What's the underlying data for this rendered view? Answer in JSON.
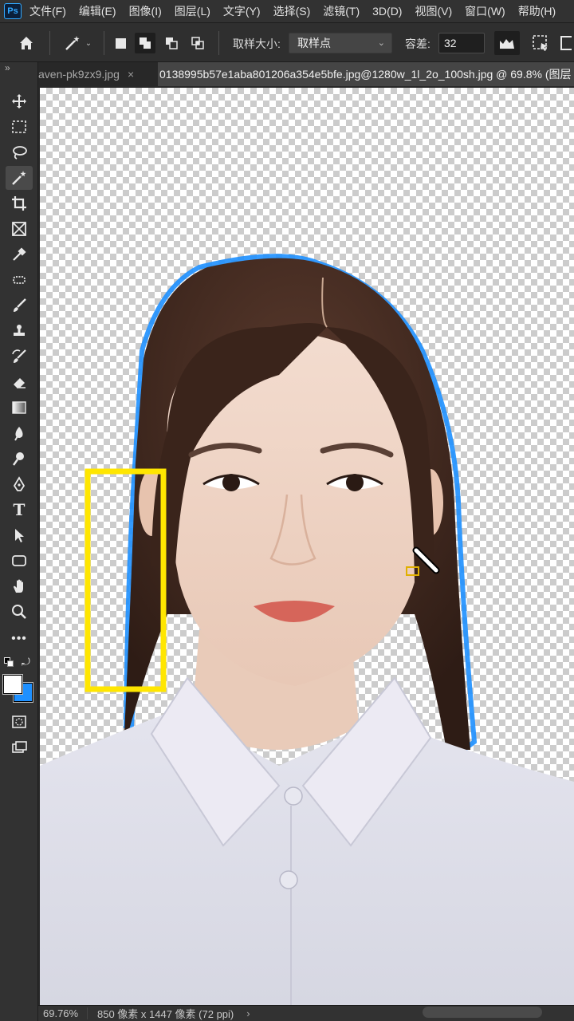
{
  "app": {
    "logo": "Ps"
  },
  "menu": [
    "文件(F)",
    "编辑(E)",
    "图像(I)",
    "图层(L)",
    "文字(Y)",
    "选择(S)",
    "滤镜(T)",
    "3D(D)",
    "视图(V)",
    "窗口(W)",
    "帮助(H)"
  ],
  "options": {
    "sample_size_label": "取样大小:",
    "sample_size_value": "取样点",
    "tolerance_label": "容差:",
    "tolerance_value": "32"
  },
  "tabs": {
    "inactive_label": "aven-pk9zx9.jpg",
    "close_glyph": "×",
    "active_label": "0138995b57e1aba801206a354e5bfe.jpg@1280w_1l_2o_100sh.jpg @ 69.8% (图层"
  },
  "status": {
    "zoom": "69.76%",
    "dimensions": "850 像素 x 1447 像素 (72 ppi)",
    "arrow": "›"
  },
  "tools": [
    "move-icon",
    "marquee-icon",
    "lasso-icon",
    "magic-wand-icon",
    "crop-icon",
    "frame-icon",
    "eyedropper-icon",
    "healing-icon",
    "brush-icon",
    "stamp-icon",
    "history-brush-icon",
    "eraser-icon",
    "gradient-icon",
    "blur-icon",
    "dodge-icon",
    "pen-icon",
    "type-icon",
    "path-select-icon",
    "shape-icon",
    "hand-icon",
    "zoom-icon",
    "more-icon"
  ],
  "colors": {
    "highlight": "#ffe600",
    "selection_fringe": "#1e90ff",
    "foreground": "#ffffff",
    "background": "#1e90ff"
  }
}
